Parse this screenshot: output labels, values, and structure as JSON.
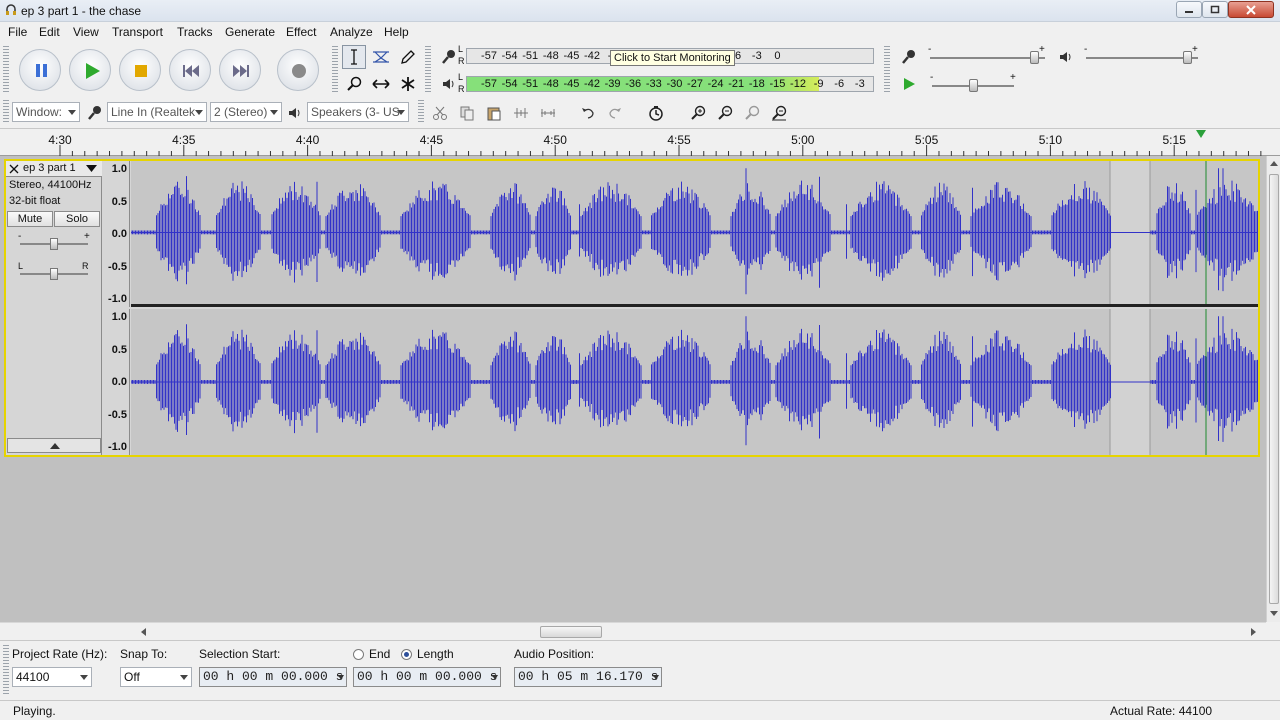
{
  "window": {
    "title": "ep 3 part 1 - the chase",
    "app_icon": "headphones-icon",
    "controls": [
      "minimize-icon",
      "maximize-icon",
      "close-icon"
    ]
  },
  "menu": [
    "File",
    "Edit",
    "View",
    "Transport",
    "Tracks",
    "Generate",
    "Effect",
    "Analyze",
    "Help"
  ],
  "transport": [
    "pause-icon",
    "play-icon",
    "stop-icon",
    "skip-start-icon",
    "skip-end-icon",
    "record-icon"
  ],
  "tools": [
    "selection-tool-icon",
    "envelope-tool-icon",
    "draw-tool-icon",
    "zoom-tool-icon",
    "timeshift-tool-icon",
    "multi-tool-icon"
  ],
  "meters": {
    "record_ticks": [
      "-57",
      "-54",
      "-51",
      "-48",
      "-45",
      "-42",
      "-3",
      "21",
      "-18",
      "-15",
      "-12",
      "-9",
      "-6",
      "-3",
      "0"
    ],
    "tooltip": "Click to Start Monitoring",
    "play_ticks": [
      "-57",
      "-54",
      "-51",
      "-48",
      "-45",
      "-42",
      "-39",
      "-36",
      "-33",
      "-30",
      "-27",
      "-24",
      "-21",
      "-18",
      "-15",
      "-12",
      "-9",
      "-6",
      "-3",
      "0"
    ],
    "play_level_db": -9,
    "lr_labels": [
      "L",
      "R"
    ]
  },
  "mixer": {
    "input_volume": 0.9,
    "output_volume": 0.9,
    "play_at_speed": 0.5,
    "minus": "-",
    "plus": "+"
  },
  "device_bar": {
    "host": "Window:",
    "input": "Line In (Realtek",
    "channels": "2 (Stereo)",
    "output": "Speakers (3- US"
  },
  "edit_tools": [
    "cut-icon",
    "copy-icon",
    "paste-icon",
    "trim-icon",
    "silence-icon",
    "undo-icon",
    "redo-icon",
    "sync-lock-icon",
    "zoom-in-icon",
    "zoom-out-icon",
    "fit-selection-icon",
    "fit-project-icon"
  ],
  "ruler": {
    "labels": [
      "4:30",
      "4:35",
      "4:40",
      "4:45",
      "4:50",
      "4:55",
      "5:00",
      "5:05",
      "5:10",
      "5:15"
    ],
    "playhead_marker": "playhead-triangle-icon"
  },
  "track": {
    "name": "ep 3 part 1",
    "info": [
      "Stereo, 44100Hz",
      "32-bit float"
    ],
    "mute": "Mute",
    "solo": "Solo",
    "gain_minus": "-",
    "gain_plus": "+",
    "pan_left": "L",
    "pan_right": "R",
    "gain": 0.5,
    "pan": 0.5,
    "y_ticks": [
      "1.0",
      "0.5",
      "0.0",
      "-0.5",
      "-1.0"
    ]
  },
  "selection_bar": {
    "project_rate_label": "Project Rate (Hz):",
    "project_rate": "44100",
    "snap_label": "Snap To:",
    "snap_value": "Off",
    "selection_start_label": "Selection Start:",
    "selection_start": "00 h 00 m 00.000 s",
    "end_label": "End",
    "length_label": "Length",
    "length_value": "00 h 00 m 00.000 s",
    "audio_position_label": "Audio Position:",
    "audio_position": "00 h 05 m 16.170 s"
  },
  "status": {
    "left": "Playing.",
    "right": "Actual Rate: 44100"
  },
  "colors": {
    "waveform": "#3232c8",
    "meter_green": "#86e07a",
    "meter_yellow": "#d6ec5a",
    "track_focus": "#e6d400",
    "playhead": "#1e8a2e"
  }
}
